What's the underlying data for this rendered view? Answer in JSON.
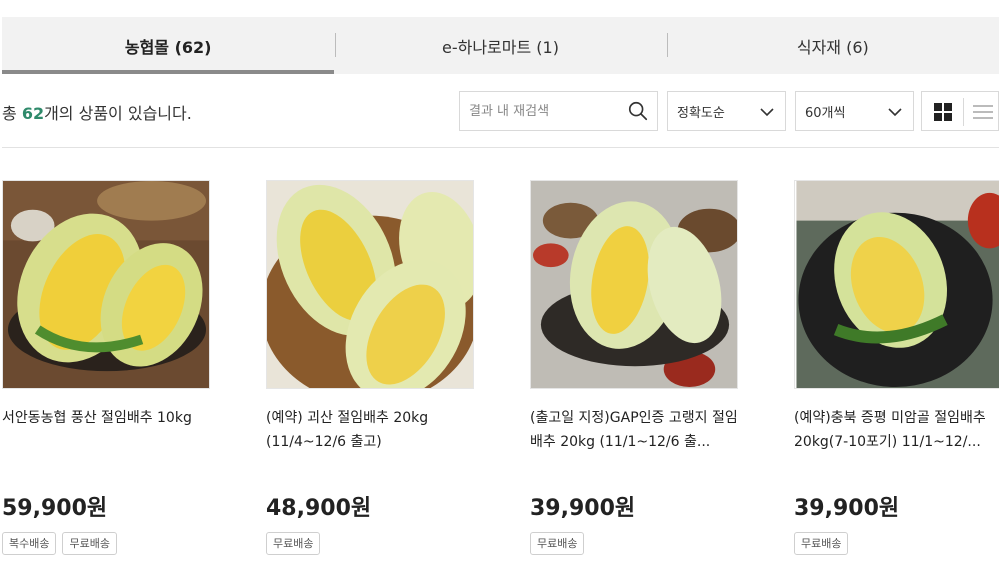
{
  "tabs": [
    {
      "label": "농협몰 (62)",
      "active": true
    },
    {
      "label": "e-하나로마트 (1)",
      "active": false
    },
    {
      "label": "식자재 (6)",
      "active": false
    }
  ],
  "result": {
    "prefix": "총 ",
    "count": "62",
    "suffix": "개의 상품이 있습니다."
  },
  "search": {
    "placeholder": "결과 내 재검색",
    "value": ""
  },
  "sort": {
    "selected": "정확도순"
  },
  "per_page": {
    "selected": "60개씩"
  },
  "view": {
    "grid": "grid-view-icon",
    "list": "list-view-icon"
  },
  "products": [
    {
      "name": "서안동농협 풍산 절임배추 10kg",
      "price": "59,900원",
      "badges": [
        "복수배송",
        "무료배송"
      ]
    },
    {
      "name": "(예약) 괴산 절임배추 20kg (11/4~12/6 출고)",
      "price": "48,900원",
      "badges": [
        "무료배송"
      ]
    },
    {
      "name": "(출고일 지정)GAP인증 고랭지 절임배추 20kg (11/1~12/6 출...",
      "price": "39,900원",
      "badges": [
        "무료배송"
      ]
    },
    {
      "name": "(예약)충북 증평 미암골 절임배추 20kg(7-10포기) 11/1~12/...",
      "price": "39,900원",
      "badges": [
        "무료배송"
      ]
    }
  ],
  "colors": {
    "accent": "#2f8a6b",
    "tab_bg": "#f2f2f2",
    "tab_indicator": "#8a8a8a"
  }
}
